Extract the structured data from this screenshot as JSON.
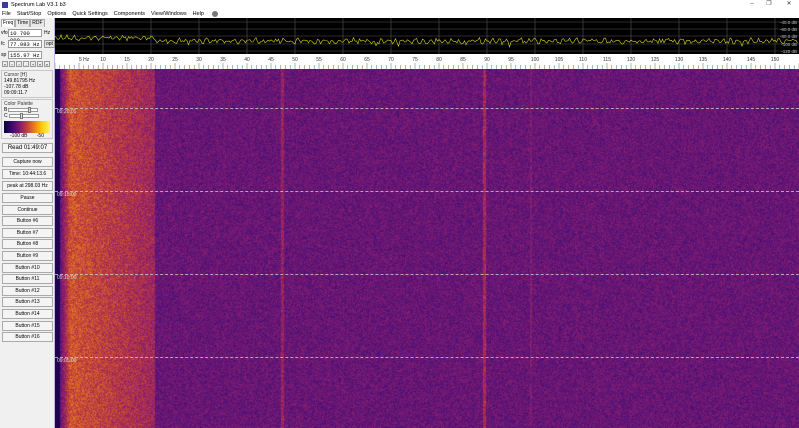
{
  "window": {
    "title": "Spectrum Lab V3.1 b3",
    "minimize": "–",
    "restore": "❐",
    "close": "✕"
  },
  "menu": [
    "File",
    "Start/Stop",
    "Options",
    "Quick Settings",
    "Components",
    "View/Windows",
    "Help"
  ],
  "left": {
    "tabs": [
      "Freq",
      "Time",
      "RDF"
    ],
    "vfo": {
      "label": "vfo",
      "value": "10 700 000",
      "unit": "Hz"
    },
    "fc": {
      "label": "fc",
      "value": "77.983 Hz",
      "button": "opt"
    },
    "sp": {
      "label": "sp",
      "value": "155.97 Hz"
    },
    "arrows": [
      "«",
      "‹",
      "›",
      "-",
      "+",
      "»",
      "»"
    ],
    "cursor": {
      "header": "Cursor [H]",
      "freq": "149.81795 Hz",
      "level": "-107.78 dB",
      "time": "09:09:11.7"
    },
    "palette": {
      "header": "Color Palette",
      "b_label": "B",
      "c_label": "C",
      "scale_min": "-100 dB",
      "scale_max": "-50",
      "b_level": 0.7,
      "c_level": 0.4
    },
    "read_button": "Read 01:49:07",
    "capture_button": "Capture now",
    "time_button": "Time:  10:44:13.6",
    "peak_button": "peak at 298.03 Hz",
    "buttons": [
      "Pause",
      "Continue",
      "Button #6",
      "Button #7",
      "Button #8",
      "Button #9",
      "Button #10",
      "Button #11",
      "Button #12",
      "Button #13",
      "Button #14",
      "Button #15",
      "Button #16"
    ]
  },
  "spectrum": {
    "db_labels": [
      "-40.0 dB",
      "-60.0 dB",
      "-80.0 dB",
      "-100 dB",
      "-120 dB"
    ],
    "trace_color": "#d8d820"
  },
  "axis": {
    "unit_label": "5  Hz",
    "labels": [
      "10",
      "15",
      "20",
      "25",
      "30",
      "35",
      "40",
      "45",
      "50",
      "55",
      "60",
      "65",
      "70",
      "75",
      "80",
      "85",
      "90",
      "95",
      "100",
      "105",
      "110",
      "115",
      "120",
      "125",
      "130",
      "135",
      "140",
      "145",
      "150"
    ]
  },
  "waterfall": {
    "time_labels": [
      "09:20:01",
      "09:15:00",
      "09:10:00",
      "09:05:00"
    ]
  }
}
